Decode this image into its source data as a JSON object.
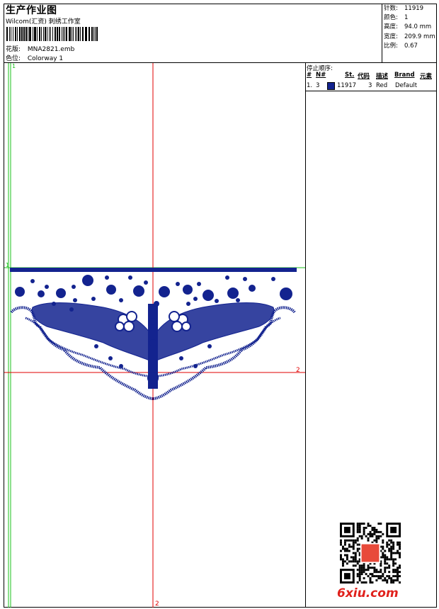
{
  "header": {
    "title": "生产作业图",
    "company": "Wilcom(汇资) 刺绣工作室",
    "design_label": "花版:",
    "design_value": "MNA2821.emb",
    "color_label": "色位:",
    "color_value": "Colorway 1"
  },
  "stats": [
    {
      "label": "针数:",
      "value": "11919"
    },
    {
      "label": "颜色:",
      "value": "1"
    },
    {
      "label": "高度:",
      "value": "94.0 mm"
    },
    {
      "label": "宽度:",
      "value": "209.9 mm"
    },
    {
      "label": "比例:",
      "value": "0.67"
    }
  ],
  "stop_sequence": {
    "title": "停止顺序:",
    "columns": [
      "#",
      "N#",
      "St.",
      "代码",
      "描述",
      "Brand",
      "元素"
    ],
    "rows": [
      {
        "index": "1.",
        "needle": "3",
        "stitches": "11917",
        "code": "3",
        "description": "Red",
        "brand": "Default",
        "element": ""
      }
    ],
    "thread_color": "#13238f"
  },
  "canvas": {
    "guide_green_v": "1",
    "guide_green_h": "1",
    "guide_red_h": "2",
    "guide_red_v": "2",
    "guide_green_color": "#18c018",
    "guide_red_color": "#e00000",
    "embroidery_color": "#13238f"
  },
  "watermark": {
    "brand": "6xiu.com",
    "brand_color": "#e0211c"
  }
}
